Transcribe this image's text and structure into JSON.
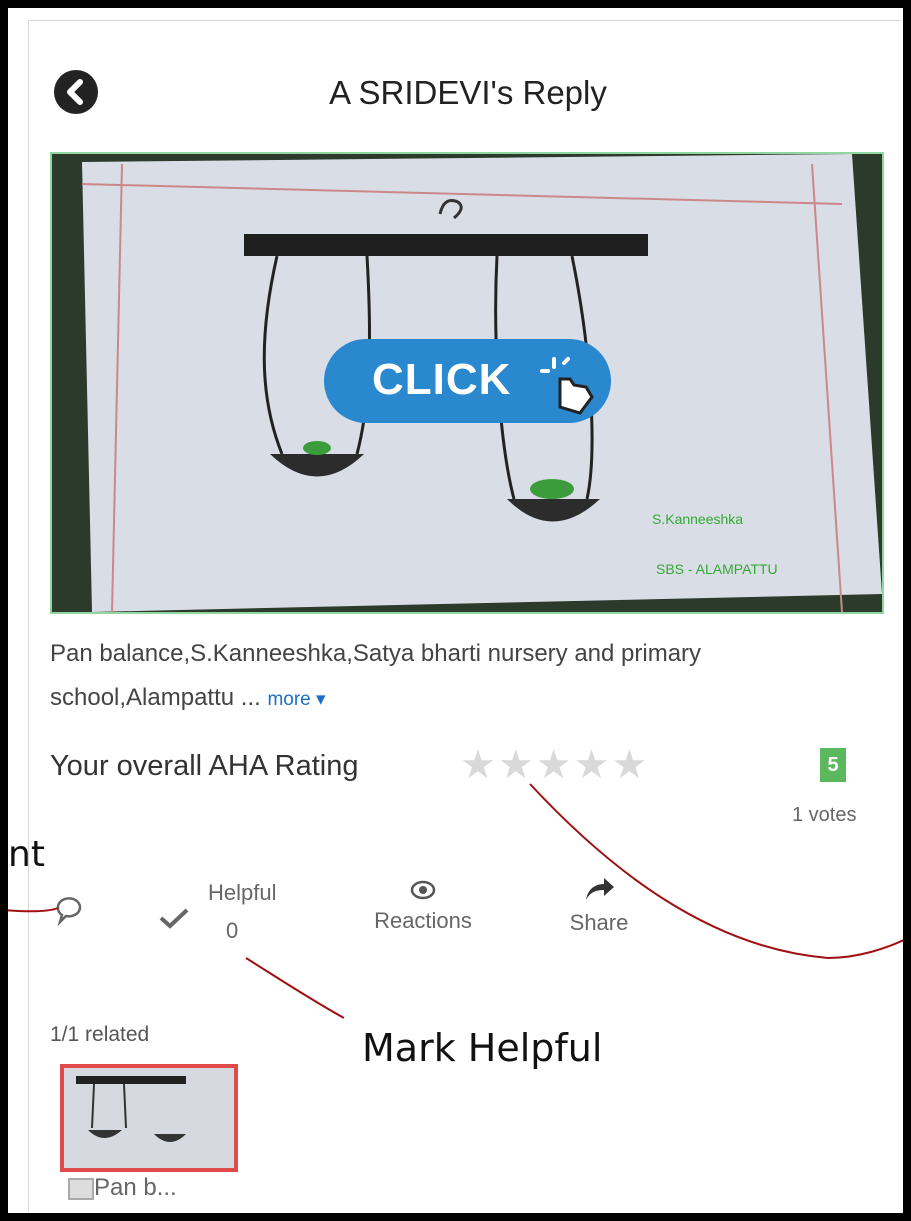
{
  "header": {
    "title": "A SRIDEVI's Reply"
  },
  "hero": {
    "overlay_label": "CLICK"
  },
  "post": {
    "description": "Pan balance,S.Kanneeshka,Satya bharti nursery and primary school,Alampattu ...",
    "more_label": "more ▾"
  },
  "rating": {
    "label": "Your overall AHA Rating",
    "stars_total": 5,
    "stars_selected": 0,
    "score": "5",
    "votes": "1 votes"
  },
  "actions": {
    "helpful_label": "Helpful",
    "helpful_count": "0",
    "reactions_label": "Reactions",
    "share_label": "Share"
  },
  "related": {
    "label": "1/1 related",
    "items": [
      {
        "caption": "Pan b..."
      }
    ]
  },
  "annotations": {
    "comment_fragment": "nt",
    "mark_helpful": "Mark Helpful"
  },
  "colors": {
    "accent": "#5cb85c",
    "overlay_blue": "#2a88cf",
    "annotation_line": "#a01010",
    "thumb_border": "#e04a4a"
  }
}
